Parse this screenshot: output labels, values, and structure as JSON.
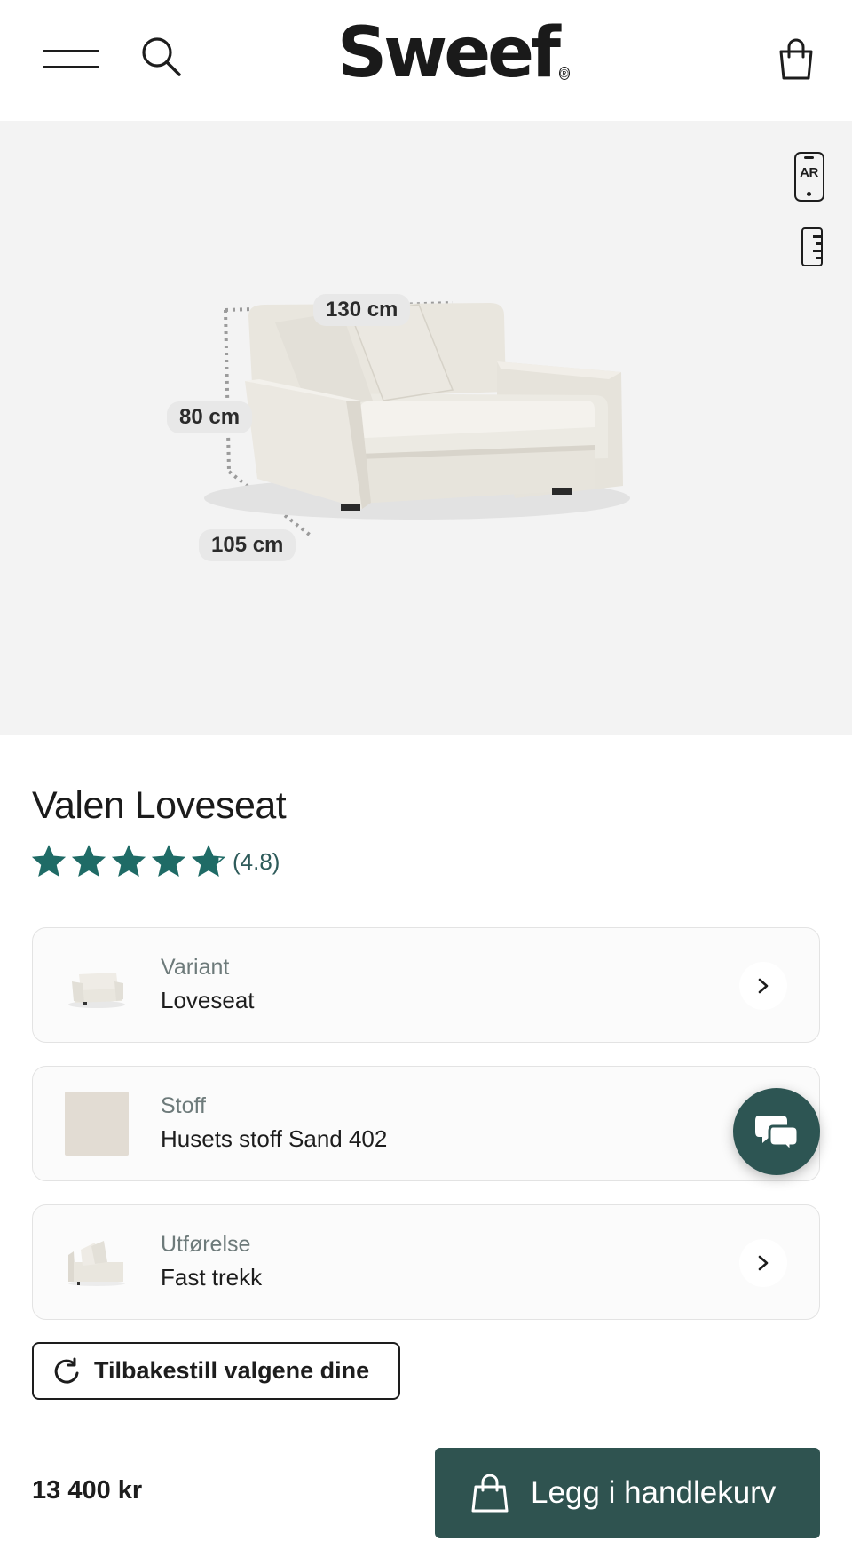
{
  "header": {
    "logo_text": "Sweef",
    "logo_mark": "®",
    "menu_icon": "hamburger-menu-icon",
    "search_icon": "search-icon",
    "cart_icon": "shopping-bag-icon"
  },
  "hero": {
    "ar_label": "AR",
    "dimensions": {
      "width": "130 cm",
      "height": "80 cm",
      "depth": "105 cm"
    }
  },
  "product": {
    "title": "Valen Loveseat",
    "rating_text": "(4.8)",
    "rating_value": 4.8,
    "rating_max": 5
  },
  "options": [
    {
      "label": "Variant",
      "value": "Loveseat",
      "thumb": "sofa-thumbnail",
      "chevron": true
    },
    {
      "label": "Stoff",
      "value": "Husets stoff Sand 402",
      "thumb": "fabric-swatch",
      "chevron": true
    },
    {
      "label": "Utførelse",
      "value": "Fast trekk",
      "thumb": "sofa-side-thumbnail",
      "chevron": true
    }
  ],
  "reset": {
    "label": "Tilbakestill valgene dine"
  },
  "footer": {
    "price": "13 400 kr",
    "cart_label": "Legg i handlekurv"
  },
  "colors": {
    "accent": "#2f5350",
    "star": "#1f6b66",
    "hero_bg": "#f3f3f3",
    "fabric": "#e2dcd3"
  }
}
